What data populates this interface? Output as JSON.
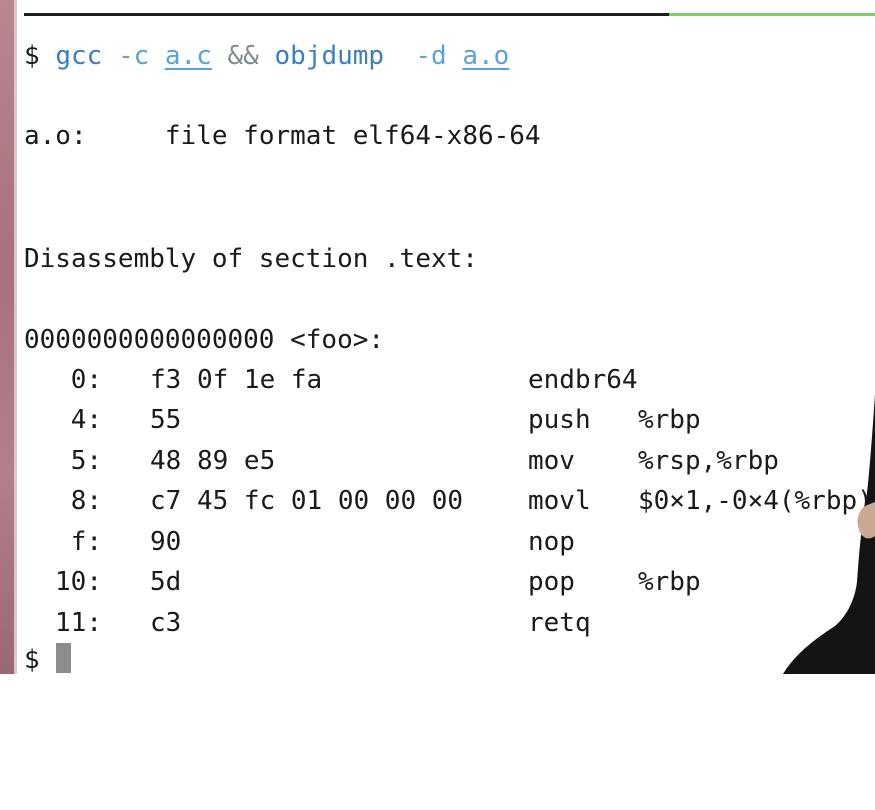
{
  "command": {
    "prompt": "$",
    "program": "gcc",
    "flag1": "-c",
    "file1": "a.c",
    "operator": "&&",
    "program2": "objdump",
    "flag2": "-d",
    "file2": "a.o"
  },
  "file_header": {
    "name": "a.o:",
    "format": "file format elf64-x86-64"
  },
  "section_header": "Disassembly of section .text:",
  "symbol_header": "0000000000000000 <foo>:",
  "instructions": [
    {
      "addr": "0:",
      "bytes": "f3 0f 1e fa",
      "mnemonic": "endbr64",
      "operands": ""
    },
    {
      "addr": "4:",
      "bytes": "55",
      "mnemonic": "push",
      "operands": "%rbp"
    },
    {
      "addr": "5:",
      "bytes": "48 89 e5",
      "mnemonic": "mov",
      "operands": "%rsp,%rbp"
    },
    {
      "addr": "8:",
      "bytes": "c7 45 fc 01 00 00 00",
      "mnemonic": "movl",
      "operands": "$0×1,-0×4(%rbp)"
    },
    {
      "addr": "f:",
      "bytes": "90",
      "mnemonic": "nop",
      "operands": ""
    },
    {
      "addr": "10:",
      "bytes": "5d",
      "mnemonic": "pop",
      "operands": "%rbp"
    },
    {
      "addr": "11:",
      "bytes": "c3",
      "mnemonic": "retq",
      "operands": ""
    }
  ],
  "final_prompt": "$",
  "colors": {
    "command_blue": "#3a7fc2",
    "argument_blue": "#5aa2d8",
    "operator_gray": "#7f8d93",
    "text": "#1a1a1a",
    "cursor": "#8c8c8c"
  }
}
